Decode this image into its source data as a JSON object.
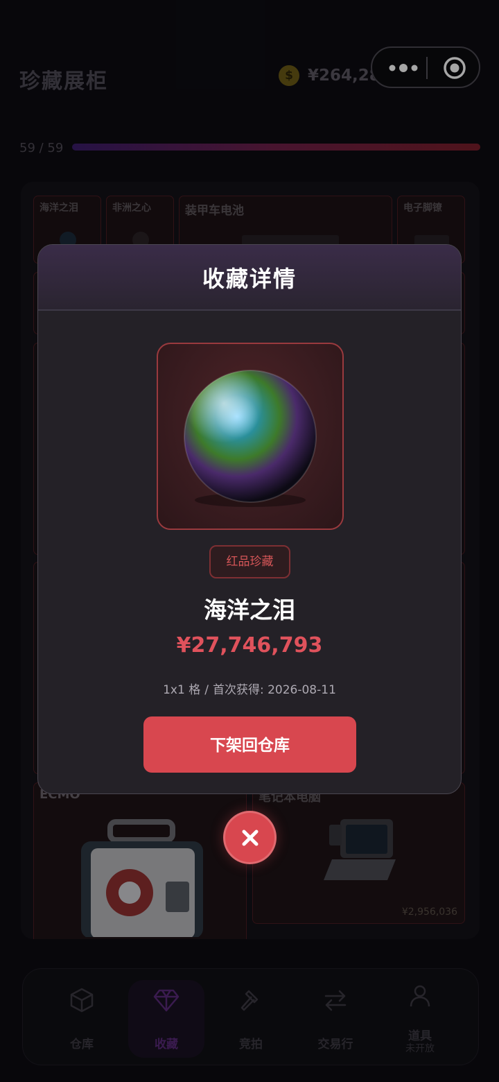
{
  "header": {
    "title": "珍藏展柜",
    "balance": "¥264,289,834",
    "coin_symbol": "$"
  },
  "progress": {
    "text": "59 / 59",
    "fraction": 1.0
  },
  "grid_items": [
    {
      "name": "海洋之泪"
    },
    {
      "name": "非洲之心"
    },
    {
      "name": "装甲车电池"
    },
    {
      "name": "电子脚镣"
    },
    {
      "name": "ECMO"
    },
    {
      "name": "笔记本电脑",
      "price": "¥2,956,036"
    }
  ],
  "bottom_nav": [
    {
      "label": "仓库",
      "icon": "box-icon"
    },
    {
      "label": "收藏",
      "icon": "diamond-icon",
      "active": true
    },
    {
      "label": "竞拍",
      "icon": "hammer-icon"
    },
    {
      "label": "交易行",
      "icon": "swap-icon"
    },
    {
      "label": "道具",
      "sub": "未开放",
      "icon": "person-icon"
    }
  ],
  "modal": {
    "title": "收藏详情",
    "rarity": "红品珍藏",
    "item_name": "海洋之泪",
    "price": "¥27,746,793",
    "size": "1x1 格",
    "acquired_label": "首次获得:",
    "acquired_date": "2026-08-11",
    "unlist_label": "下架回仓库"
  },
  "colors": {
    "accent": "#d8474f",
    "price_red": "#e0525c",
    "rarity_red": "#d55658"
  }
}
